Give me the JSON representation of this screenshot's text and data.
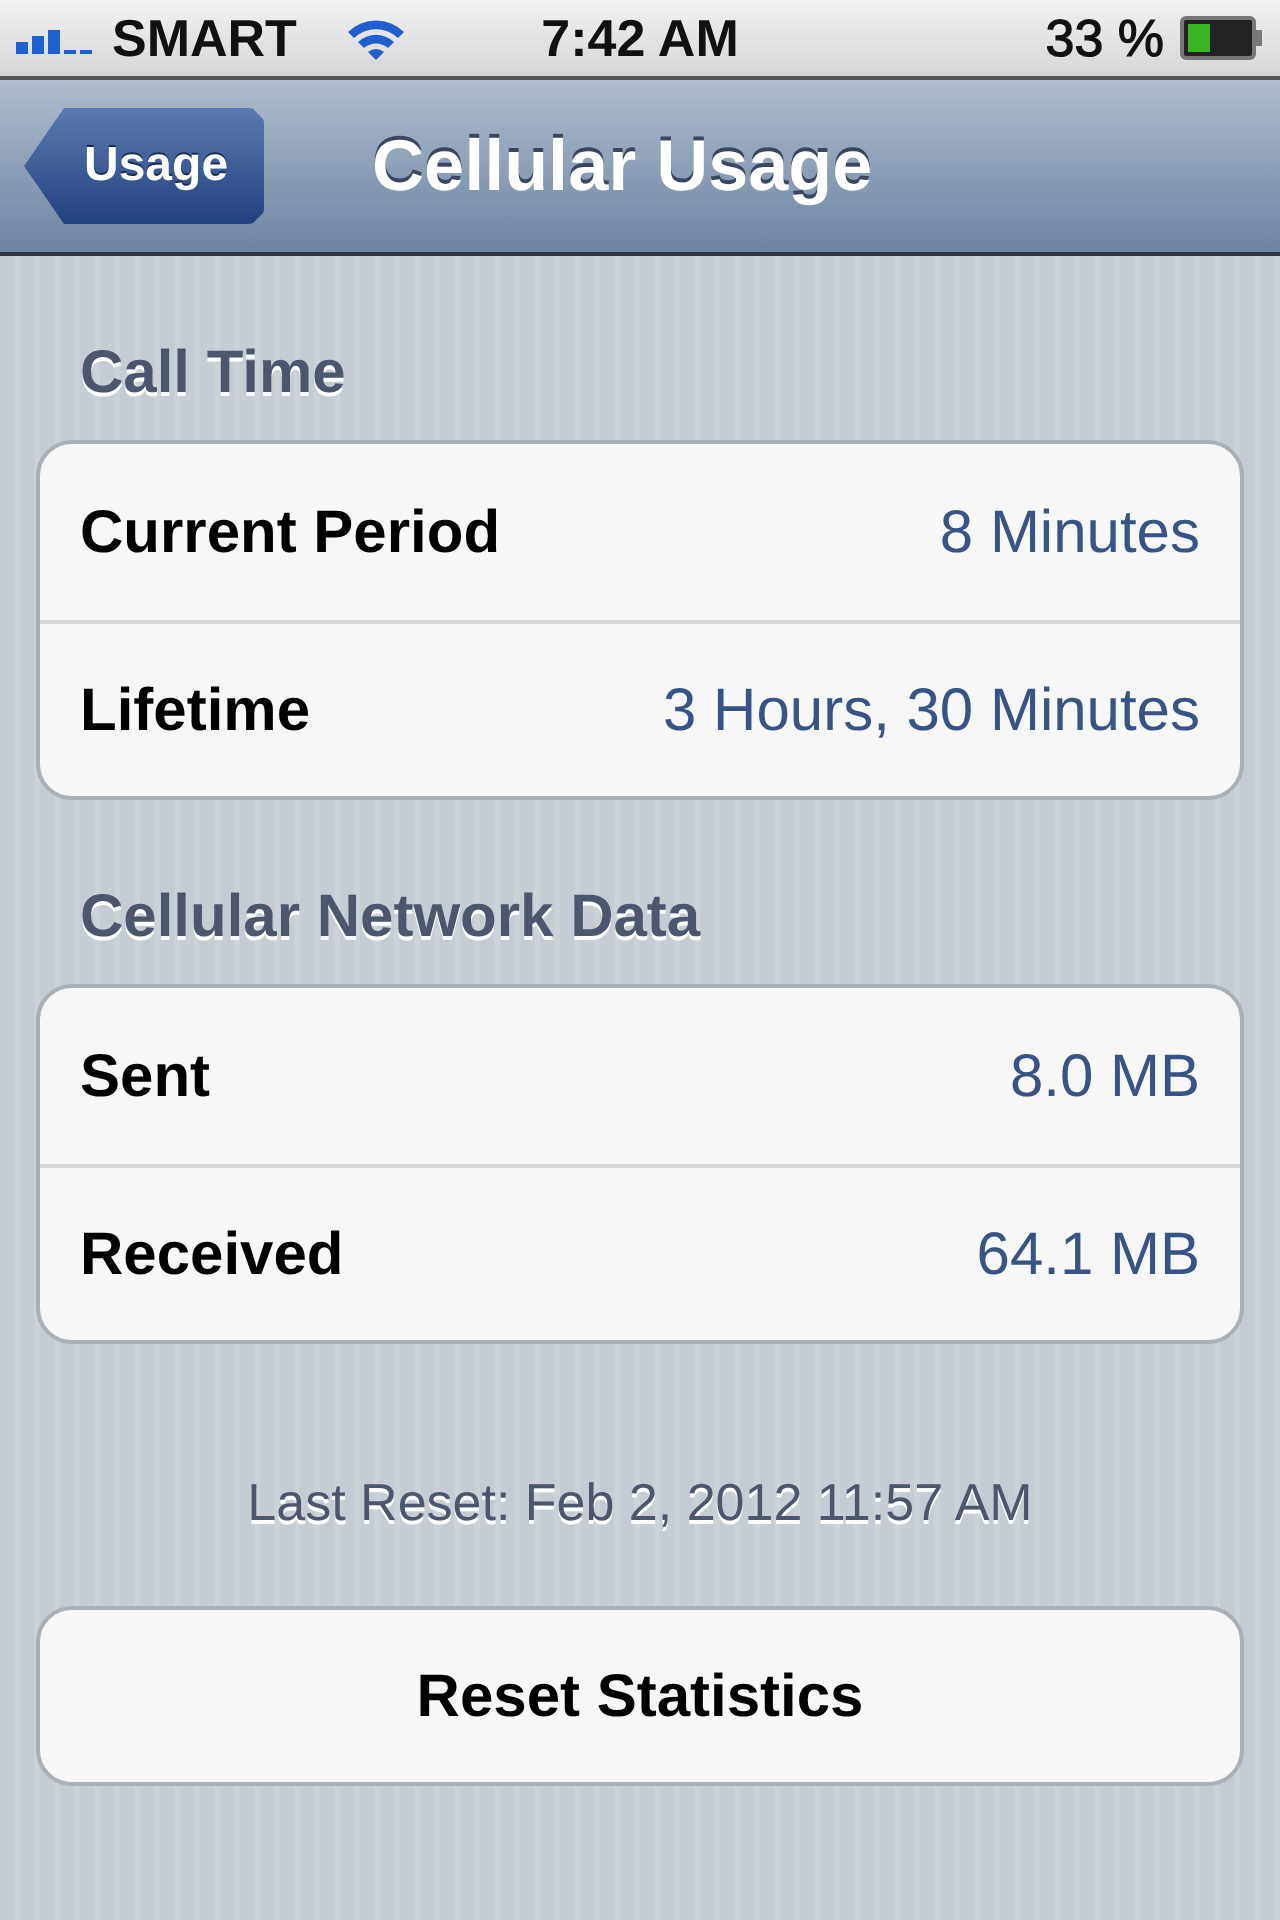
{
  "status_bar": {
    "carrier": "SMART",
    "time": "7:42 AM",
    "battery": "33 %"
  },
  "nav_bar": {
    "back_button": "Usage",
    "title": "Cellular Usage"
  },
  "sections": [
    {
      "header": "Call Time",
      "rows": [
        {
          "label": "Current Period",
          "value": "8 Minutes"
        },
        {
          "label": "Lifetime",
          "value": "3 Hours, 30 Minutes"
        }
      ]
    },
    {
      "header": "Cellular Network Data",
      "rows": [
        {
          "label": "Sent",
          "value": "8.0 MB"
        },
        {
          "label": "Received",
          "value": "64.1 MB"
        }
      ]
    }
  ],
  "footer": "Last Reset: Feb 2, 2012 11:57 AM",
  "reset_button": "Reset Statistics"
}
